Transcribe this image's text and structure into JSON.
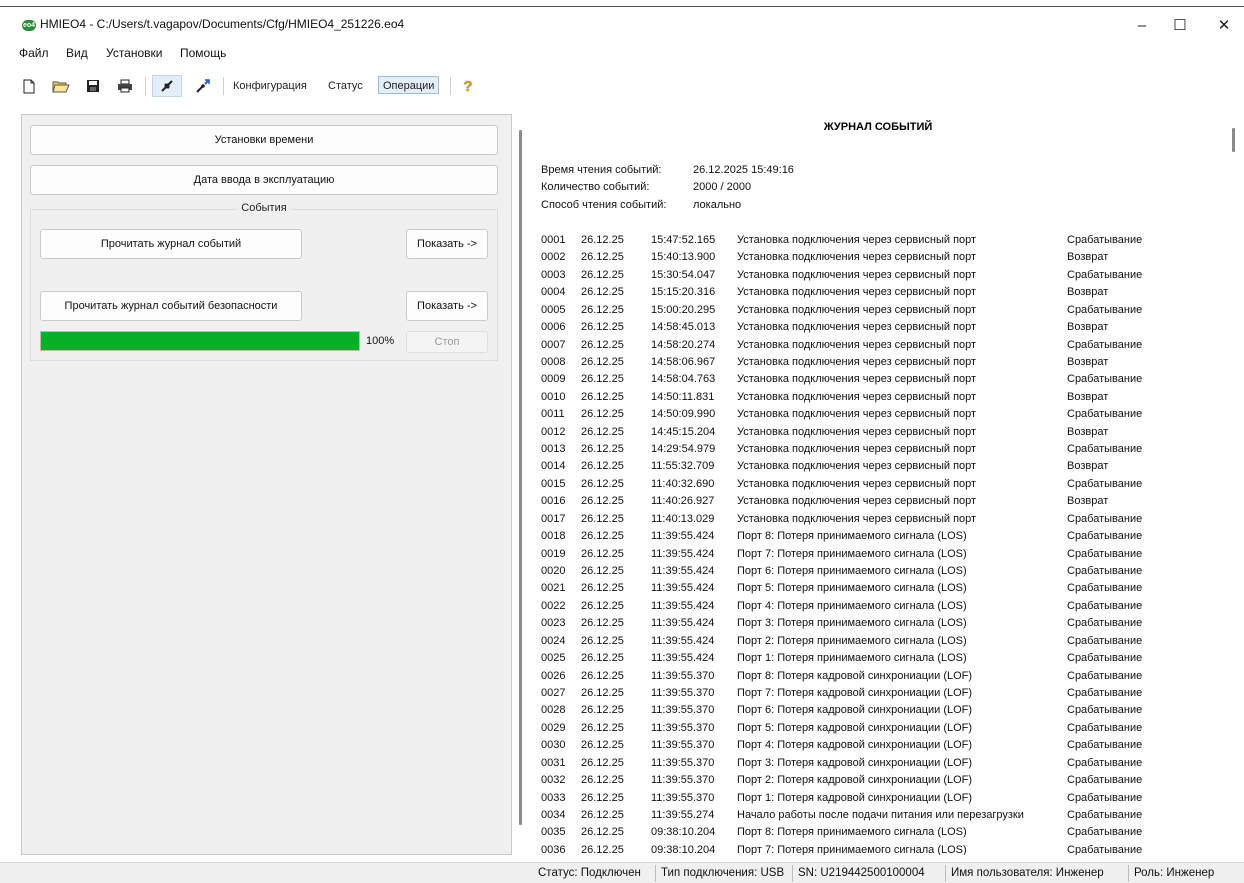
{
  "window": {
    "title": "HMIEO4 - C:/Users/t.vagapov/Documents/Cfg/HMIEO4_251226.eo4",
    "app_icon_text": "eo4"
  },
  "menu": [
    {
      "label": "Файл"
    },
    {
      "label": "Вид"
    },
    {
      "label": "Установки"
    },
    {
      "label": "Помощь"
    }
  ],
  "toolbar": {
    "icons": [
      "new-file-icon",
      "open-folder-icon",
      "save-icon",
      "print-icon",
      "connect-icon",
      "disconnect-icon",
      "help-icon"
    ],
    "tabs": [
      "Конфигурация",
      "Статус",
      "Операции"
    ],
    "selected_tab": "Операции"
  },
  "left": {
    "time_settings_label": "Установки времени",
    "commission_date_label": "Дата ввода в эксплуатацию",
    "events_group_label": "События",
    "read_log_label": "Прочитать журнал событий",
    "show_label_1": "Показать ->",
    "read_security_log_label": "Прочитать журнал событий безопасности",
    "show_label_2": "Показать ->",
    "progress_percent": "100%",
    "progress_value": 1.0,
    "stop_label": "Стоп"
  },
  "journal": {
    "title": "ЖУРНАЛ СОБЫТИЙ",
    "read_time_label": "Время чтения событий:",
    "read_time_value": "26.12.2025 15:49:16",
    "count_label": "Количество событий:",
    "count_value": "2000 / 2000",
    "method_label": "Способ чтения событий:",
    "method_value": "локально",
    "events": [
      {
        "n": "0001",
        "d": "26.12.25",
        "t": "15:47:52.165",
        "m": "Установка подключения через сервисный порт",
        "k": "Срабатывание"
      },
      {
        "n": "0002",
        "d": "26.12.25",
        "t": "15:40:13.900",
        "m": "Установка подключения через сервисный порт",
        "k": "Возврат"
      },
      {
        "n": "0003",
        "d": "26.12.25",
        "t": "15:30:54.047",
        "m": "Установка подключения через сервисный порт",
        "k": "Срабатывание"
      },
      {
        "n": "0004",
        "d": "26.12.25",
        "t": "15:15:20.316",
        "m": "Установка подключения через сервисный порт",
        "k": "Возврат"
      },
      {
        "n": "0005",
        "d": "26.12.25",
        "t": "15:00:20.295",
        "m": "Установка подключения через сервисный порт",
        "k": "Срабатывание"
      },
      {
        "n": "0006",
        "d": "26.12.25",
        "t": "14:58:45.013",
        "m": "Установка подключения через сервисный порт",
        "k": "Возврат"
      },
      {
        "n": "0007",
        "d": "26.12.25",
        "t": "14:58:20.274",
        "m": "Установка подключения через сервисный порт",
        "k": "Срабатывание"
      },
      {
        "n": "0008",
        "d": "26.12.25",
        "t": "14:58:06.967",
        "m": "Установка подключения через сервисный порт",
        "k": "Возврат"
      },
      {
        "n": "0009",
        "d": "26.12.25",
        "t": "14:58:04.763",
        "m": "Установка подключения через сервисный порт",
        "k": "Срабатывание"
      },
      {
        "n": "0010",
        "d": "26.12.25",
        "t": "14:50:11.831",
        "m": "Установка подключения через сервисный порт",
        "k": "Возврат"
      },
      {
        "n": "0011",
        "d": "26.12.25",
        "t": "14:50:09.990",
        "m": "Установка подключения через сервисный порт",
        "k": "Срабатывание"
      },
      {
        "n": "0012",
        "d": "26.12.25",
        "t": "14:45:15.204",
        "m": "Установка подключения через сервисный порт",
        "k": "Возврат"
      },
      {
        "n": "0013",
        "d": "26.12.25",
        "t": "14:29:54.979",
        "m": "Установка подключения через сервисный порт",
        "k": "Срабатывание"
      },
      {
        "n": "0014",
        "d": "26.12.25",
        "t": "11:55:32.709",
        "m": "Установка подключения через сервисный порт",
        "k": "Возврат"
      },
      {
        "n": "0015",
        "d": "26.12.25",
        "t": "11:40:32.690",
        "m": "Установка подключения через сервисный порт",
        "k": "Срабатывание"
      },
      {
        "n": "0016",
        "d": "26.12.25",
        "t": "11:40:26.927",
        "m": "Установка подключения через сервисный порт",
        "k": "Возврат"
      },
      {
        "n": "0017",
        "d": "26.12.25",
        "t": "11:40:13.029",
        "m": "Установка подключения через сервисный порт",
        "k": "Срабатывание"
      },
      {
        "n": "0018",
        "d": "26.12.25",
        "t": "11:39:55.424",
        "m": "Порт 8: Потеря принимаемого сигнала (LOS)",
        "k": "Срабатывание"
      },
      {
        "n": "0019",
        "d": "26.12.25",
        "t": "11:39:55.424",
        "m": "Порт 7: Потеря принимаемого сигнала (LOS)",
        "k": "Срабатывание"
      },
      {
        "n": "0020",
        "d": "26.12.25",
        "t": "11:39:55.424",
        "m": "Порт 6: Потеря принимаемого сигнала (LOS)",
        "k": "Срабатывание"
      },
      {
        "n": "0021",
        "d": "26.12.25",
        "t": "11:39:55.424",
        "m": "Порт 5: Потеря принимаемого сигнала (LOS)",
        "k": "Срабатывание"
      },
      {
        "n": "0022",
        "d": "26.12.25",
        "t": "11:39:55.424",
        "m": "Порт 4: Потеря принимаемого сигнала (LOS)",
        "k": "Срабатывание"
      },
      {
        "n": "0023",
        "d": "26.12.25",
        "t": "11:39:55.424",
        "m": "Порт 3: Потеря принимаемого сигнала (LOS)",
        "k": "Срабатывание"
      },
      {
        "n": "0024",
        "d": "26.12.25",
        "t": "11:39:55.424",
        "m": "Порт 2: Потеря принимаемого сигнала (LOS)",
        "k": "Срабатывание"
      },
      {
        "n": "0025",
        "d": "26.12.25",
        "t": "11:39:55.424",
        "m": "Порт 1: Потеря принимаемого сигнала (LOS)",
        "k": "Срабатывание"
      },
      {
        "n": "0026",
        "d": "26.12.25",
        "t": "11:39:55.370",
        "m": "Порт 8: Потеря кадровой синхрониации (LOF)",
        "k": "Срабатывание"
      },
      {
        "n": "0027",
        "d": "26.12.25",
        "t": "11:39:55.370",
        "m": "Порт 7: Потеря кадровой синхрониации (LOF)",
        "k": "Срабатывание"
      },
      {
        "n": "0028",
        "d": "26.12.25",
        "t": "11:39:55.370",
        "m": "Порт 6: Потеря кадровой синхрониации (LOF)",
        "k": "Срабатывание"
      },
      {
        "n": "0029",
        "d": "26.12.25",
        "t": "11:39:55.370",
        "m": "Порт 5: Потеря кадровой синхрониации (LOF)",
        "k": "Срабатывание"
      },
      {
        "n": "0030",
        "d": "26.12.25",
        "t": "11:39:55.370",
        "m": "Порт 4: Потеря кадровой синхрониации (LOF)",
        "k": "Срабатывание"
      },
      {
        "n": "0031",
        "d": "26.12.25",
        "t": "11:39:55.370",
        "m": "Порт 3: Потеря кадровой синхрониации (LOF)",
        "k": "Срабатывание"
      },
      {
        "n": "0032",
        "d": "26.12.25",
        "t": "11:39:55.370",
        "m": "Порт 2: Потеря кадровой синхрониации (LOF)",
        "k": "Срабатывание"
      },
      {
        "n": "0033",
        "d": "26.12.25",
        "t": "11:39:55.370",
        "m": "Порт 1: Потеря кадровой синхрониации (LOF)",
        "k": "Срабатывание"
      },
      {
        "n": "0034",
        "d": "26.12.25",
        "t": "11:39:55.274",
        "m": "Начало работы после подачи питания или перезагрузки",
        "k": "Срабатывание"
      },
      {
        "n": "0035",
        "d": "26.12.25",
        "t": "09:38:10.204",
        "m": "Порт 8: Потеря принимаемого сигнала (LOS)",
        "k": "Срабатывание"
      },
      {
        "n": "0036",
        "d": "26.12.25",
        "t": "09:38:10.204",
        "m": "Порт 7: Потеря принимаемого сигнала (LOS)",
        "k": "Срабатывание"
      }
    ]
  },
  "status": {
    "state": "Статус: Подключен",
    "conn_type": "Тип подключения: USB",
    "serial": "SN: U219442500100004",
    "user": "Имя пользователя: Инженер",
    "role": "Роль: Инженер"
  },
  "colors": {
    "progress_fill": "#06b025",
    "selected_tab_bg": "#e4eef8"
  }
}
